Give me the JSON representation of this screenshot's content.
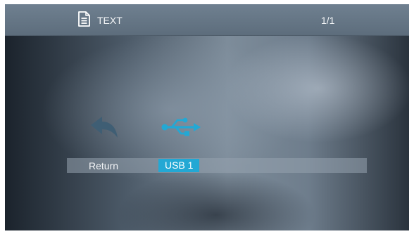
{
  "header": {
    "title": "TEXT",
    "page_indicator": "1/1",
    "icon": "document-icon"
  },
  "devices": {
    "items": [
      {
        "label": "Return",
        "icon": "return-arrow-icon",
        "selected": false
      },
      {
        "label": "USB 1",
        "icon": "usb-icon",
        "selected": true
      }
    ]
  },
  "colors": {
    "accent": "#23a8d4",
    "return_icon": "#3f5e74",
    "text": "#f2f4f6"
  }
}
